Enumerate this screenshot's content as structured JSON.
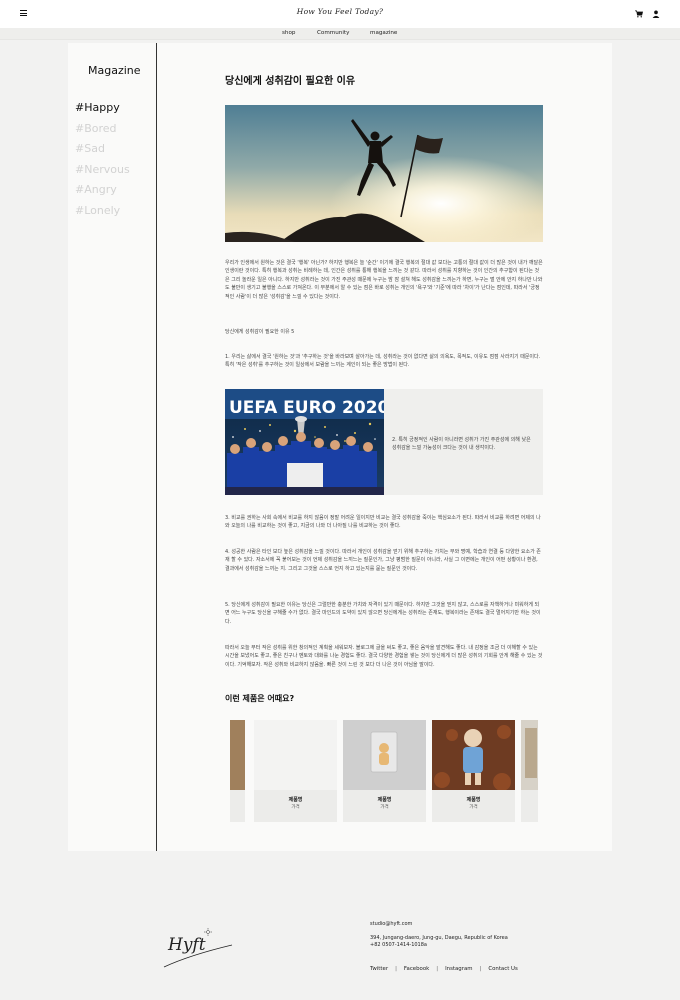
{
  "header": {
    "logo_text": "How You Feel Today?",
    "menu_icon": "hamburger-menu-icon",
    "cart_icon": "shopping-cart-icon",
    "user_icon": "user-icon"
  },
  "nav": {
    "items": [
      "shop",
      "Community",
      "magazine"
    ]
  },
  "sidebar": {
    "title": "Magazine",
    "tags": [
      {
        "label": "#Happy",
        "active": true
      },
      {
        "label": "#Bored",
        "active": false
      },
      {
        "label": "#Sad",
        "active": false
      },
      {
        "label": "#Nervous",
        "active": false
      },
      {
        "label": "#Angry",
        "active": false
      },
      {
        "label": "#Lonely",
        "active": false
      }
    ]
  },
  "article": {
    "title": "당신에게 성취감이 필요한 이유",
    "intro": "우리가 인생에서 원하는 것은 결국 '행복' 아닌가? 하지만 행복은 늘 '순간' 이기에 결국 행복의 절대 값 보다는 고통의 절대 값이 더 많은 것이 내가 깨달은 인생이란 것이다. 특히 행복과 성취는 비례하는 데, 인간은 성취를 통해 행복을 느끼는 것 같다. 따라서 성취를 지향하는 것이 인간의 추구함이 된다는 것은 그리 놀라운 일은 아니다. 하지만 성취라는 것이 가진 주관성 때문에 누구는 밤 잠 설쳐 해도 성취감을 느끼는가 하면, 누구는 벌 안에 안지 하나만 나와도 불만이 생기고 불행을 스스로 가져온다. 이 부분에서 알 수 있는 점은 바로 성취는 개인의 '욕구'와 '기준'에 따라 '차이'가 난다는 점인데, 따라서 '긍정적인 사람'이 더 많은 '성취감'을 느낄 수 있다는 것이다.",
    "subheading": "당신에게 성취감이 필요한 이유 5",
    "point1": "1. 우리는 삶에서 결국 '원하는 것'과 '추구하는 것'을 바라보며 살아가는 데, 성취라는 것이 없다면 삶의 의욕도, 목적도, 이유도 점점 사라지기 때문이다. 특히 '작은 성취'를 추구하는 것이 일상에서 보람을 느끼는 계인이 되는 좋은 방법이 된다.",
    "point2": "2. 특히 긍정적인 사람이 아니라면 성취가 가진 주관성에 의해 낮은 성취감을 느낄 가능성이 크다는 것이 내 생각이다.",
    "point3": "3. 비교를 권하는 사회 속에서 비교를 하지 않음이 정말 어려운 일이지만 비교는 결국 성취감을 죽이는 핵심요소가 된다. 따라서 비교를 하려면 어제의 나와 오늘의 나를 비교하는 것이 좋고, 지금의 나와 더 나아질 나를 비교하는 것이 좋다.",
    "point4": "4. 성공한 사람은 타인 보다 높은 성취감을 느낄 것이다. 따라서 개인이 성취감을 얻기 위해 추구하는 가치는 부와 명예, 학습과 연결 등 다양한 요소가 존재 할 수 있다. 자소서에 꼭 붙어보는 것이 언제 성취감을 느끼느는 질문인가, 그냥 평범한 질문이 아니라, 사실 그 이면에는 개인이 어떤 상황이나 환경, 결과에서 성취감을 느끼는 지. 그리고 그것을 스스로 언지 하고 있는지를 묻는 질문인 것이다.",
    "point5": "5. 당신에게 성취감이 필요한 이유는 당신은 그럴만한 충분한 가치와 자격이 있기 때문이다. 하지만 그것을 믿지 않고, 스스로를 자책하거나 미워하게 되면 어느 누구도 당신을 구해줄 수가 없다. 결국 마인드의 도약이 있지 않으면 당신에게는 성취라는 존재도, 행복이라는 존재도 결국 멀어지기만 하는 것이다.",
    "conclusion": "따라서 오늘 부터 작은 성취를 위한 창의적인 계획을 세워보자. 블로그에 글을 써도 좋고, 좋은 음악을 발견해도 좋다. 내 감정을 조금 더 이해할 수 있는 시간을 보냈어도 좋고, 좋은 친구나 멘토와 대화를 나눈 경험도 좋다. 결국 다양한 경험을 쌓는 것이 당신에게 더 많은 성취의 기회를 안게 해줄 수 있는 것이다. 기억해보자. 작은 성취와 비교하지 않음을. 빠른 것이 느린 것 보다 더 나은 것이 아님을 말이다."
  },
  "recommend": {
    "title": "이런 제품은 어때요?",
    "products": [
      {
        "name": "제품명",
        "price": "가격"
      },
      {
        "name": "제품명",
        "price": "가격"
      },
      {
        "name": "제품명",
        "price": "가격"
      }
    ]
  },
  "footer": {
    "logo_text": "Hyft",
    "email": "studio@hyft.com",
    "address": "394, Jungang-daero, Jung-gu, Daegu, Republic of Korea",
    "phone": "+82 0507-1414-1018a",
    "links": [
      "Twitter",
      "Facebook",
      "Instagram",
      "Contact Us"
    ]
  },
  "colors": {
    "accent": "#111111",
    "inactive_tag": "#d2d2d2",
    "page_bg": "#f2f2f1",
    "panel_bg": "#fafaf9"
  }
}
